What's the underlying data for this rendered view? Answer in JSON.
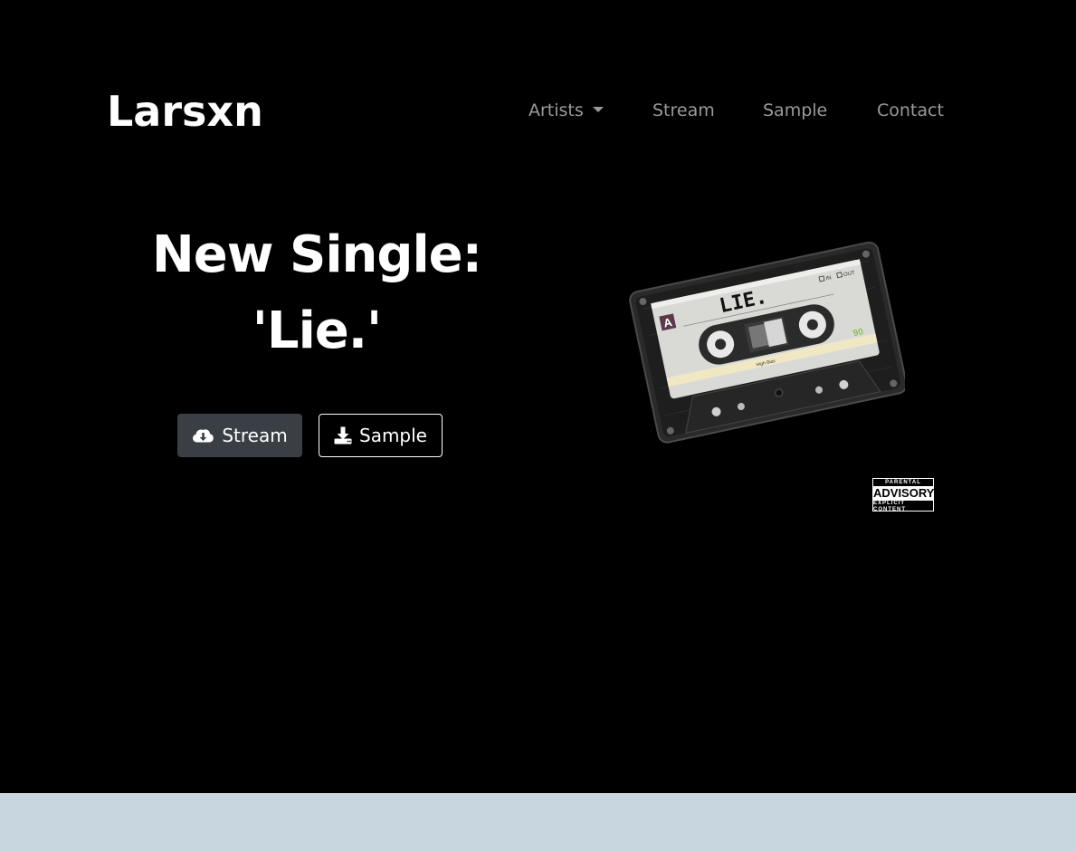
{
  "header": {
    "brand": "Larsxn",
    "nav": {
      "artists": "Artists",
      "stream": "Stream",
      "sample": "Sample",
      "contact": "Contact"
    }
  },
  "hero": {
    "headline_line1": "New Single:",
    "headline_line2": "'Lie.'",
    "stream_button": "Stream",
    "sample_button": "Sample",
    "cassette": {
      "label_title": "LIE.",
      "side": "A",
      "length": "90",
      "tape_type": "High Bias",
      "check_in": "IN",
      "check_out": "OUT"
    },
    "advisory": {
      "top": "PARENTAL",
      "middle": "ADVISORY",
      "bottom": "EXPLICIT CONTENT"
    }
  },
  "colors": {
    "background": "#000000",
    "nav_text": "#9a9a9a",
    "stream_button_bg": "#3a3f45",
    "footer_band": "#c8d6e0"
  },
  "icons": {
    "stream_button_icon": "cloud-download-icon",
    "sample_button_icon": "download-icon",
    "nav_artists_icon": "caret-down-icon"
  }
}
